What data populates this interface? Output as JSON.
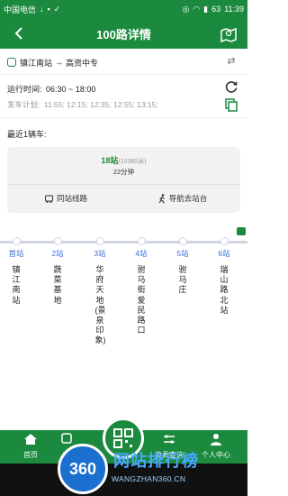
{
  "status_bar": {
    "carrier": "中国电信",
    "time": "11:39",
    "battery": "63"
  },
  "header": {
    "title": "100路详情"
  },
  "route": {
    "from": "镇江南站",
    "arrow": "→",
    "to": "高资中专"
  },
  "schedule": {
    "run_time_label": "运行时间:",
    "run_time": "06:30 ~ 18:00",
    "plan_label": "发车计划:",
    "plan": "11:55; 12:15; 12:35; 12:55; 13:15;"
  },
  "nearest": {
    "label": "最近1辆车:",
    "stops": "18站",
    "distance": "(10385米)",
    "minutes": "22分钟",
    "same_line_label": "同站线路",
    "navigate_label": "导航去站台"
  },
  "stops": [
    {
      "num": "首站",
      "name": "镇江南站"
    },
    {
      "num": "2站",
      "name": "蔬菜基地"
    },
    {
      "num": "3站",
      "name": "华府天地(景泉印象)"
    },
    {
      "num": "4站",
      "name": "驸马街爱民路口"
    },
    {
      "num": "5站",
      "name": "驸马庄"
    },
    {
      "num": "6站",
      "name": "瑞山路北站"
    }
  ],
  "tabs": {
    "home": "首页",
    "realtime": "实",
    "profile": "个人中心",
    "mid": "换乘查询"
  },
  "watermark": {
    "badge": "360",
    "name": "网站排行榜",
    "url": "WANGZHAN360.CN"
  },
  "colors": {
    "primary": "#1b8a3e",
    "stop_number": "#3a6fd8",
    "track": "#cfd6e0"
  }
}
